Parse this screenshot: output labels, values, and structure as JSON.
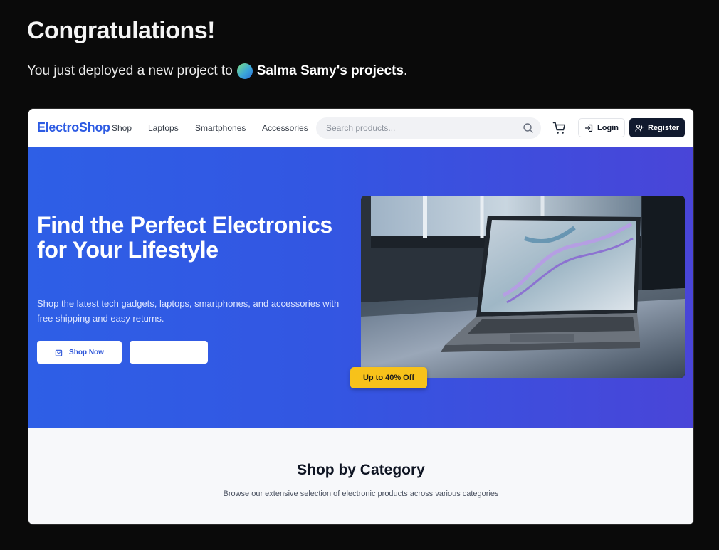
{
  "deploy": {
    "title": "Congratulations!",
    "message_prefix": "You just deployed a new project to",
    "owner": "Salma Samy's projects",
    "message_suffix": "."
  },
  "site": {
    "nav": {
      "logo": "ElectroShop",
      "links": [
        "Shop",
        "Laptops",
        "Smartphones",
        "Accessories"
      ],
      "search_placeholder": "Search products...",
      "login_label": "Login",
      "register_label": "Register"
    },
    "hero": {
      "headline": "Find the Perfect Electronics for Your Lifestyle",
      "lead": "Shop the latest tech gadgets, laptops, smartphones, and accessories with free shipping and easy returns.",
      "primary_button": "Shop Now",
      "secondary_button": "",
      "badge": "Up to 40% Off"
    },
    "categories": {
      "title": "Shop by Category",
      "subtitle": "Browse our extensive selection of electronic products across various categories"
    }
  },
  "colors": {
    "page_background": "#0a0a0a",
    "brand": "#2d5be3",
    "hero_start": "#2e5fe6",
    "hero_end": "#4945d8",
    "badge": "#f7c21a",
    "register_button": "#111a2e"
  },
  "icons": [
    "search-icon",
    "cart-icon",
    "login-icon",
    "user-plus-icon",
    "shopping-bag-icon"
  ]
}
